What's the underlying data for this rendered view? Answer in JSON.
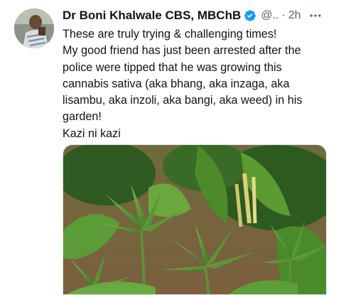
{
  "tweet": {
    "author": {
      "display_name": "Dr Boni Khalwale CBS, MBChB",
      "handle": "@..",
      "verified": true
    },
    "separator": "·",
    "time": "2h",
    "text_lines": [
      "These are truly trying & challenging times!",
      "My good friend has just been arrested after the",
      "police were tipped that he was growing this",
      "cannabis sativa (aka bhang, aka inzaga, aka",
      "lisambu, aka inzoli, aka bangi, aka weed) in his",
      "garden!",
      "Kazi ni kazi"
    ],
    "media": {
      "description_icon": "cannabis-plants-photo"
    }
  },
  "colors": {
    "text": "#0f1419",
    "secondary": "#536471",
    "verified": "#1d9bf0",
    "foliage": "#4f8a2c"
  },
  "icons": {
    "verified": "verified-badge-icon",
    "more": "more-options-icon"
  }
}
